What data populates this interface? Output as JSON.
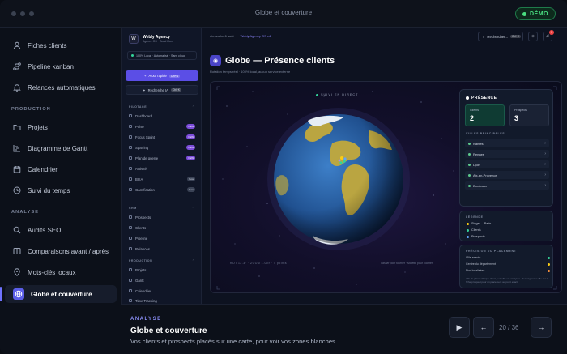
{
  "window": {
    "title": "Globe et couverture",
    "demo_badge": "DÉMO"
  },
  "left_nav": {
    "items_top": [
      "Fiches clients",
      "Pipeline kanban",
      "Relances automatiques"
    ],
    "section_production": "PRODUCTION",
    "items_production": [
      "Projets",
      "Diagramme de Gantt",
      "Calendrier",
      "Suivi du temps"
    ],
    "section_analyse": "ANALYSE",
    "items_analyse": [
      "Audits SEO",
      "Comparaisons avant / après",
      "Mots-clés locaux",
      "Globe et couverture"
    ],
    "active": "Globe et couverture"
  },
  "app": {
    "brand": {
      "name": "Webly Agency",
      "sub": "Agency OS · Good Run"
    },
    "local_status": "100% Local · Automatisé · Sans cloud",
    "quick_add": {
      "label": "Ajout rapide",
      "shortcut": "Ctrl+N"
    },
    "ai_search": {
      "label": "Recherche IA",
      "shortcut": "Ctrl+K"
    },
    "groups": {
      "pilotage": "PILOTAGE",
      "pilotage_items": [
        {
          "label": "Dashboard",
          "badge": ""
        },
        {
          "label": "Pulse",
          "badge": "NEW"
        },
        {
          "label": "Focus Sprint",
          "badge": "NEW"
        },
        {
          "label": "Sparring",
          "badge": "NEW"
        },
        {
          "label": "Plan de guerre",
          "badge": "NEW"
        },
        {
          "label": "Activité",
          "badge": ""
        },
        {
          "label": "BI IA",
          "badge": "Beta"
        },
        {
          "label": "Gamification",
          "badge": "Beta"
        }
      ],
      "crm": "CRM",
      "crm_items": [
        "Prospects",
        "Clients",
        "Pipeline",
        "Relances"
      ],
      "production": "PRODUCTION",
      "production_items": [
        "Projets",
        "Gantt",
        "Calendrier",
        "Time Tracking"
      ]
    },
    "breadcrumb": {
      "date": "dimanche 6 août",
      "context": "Webly Agency OS v4"
    },
    "search": {
      "label": "Rechercher...",
      "shortcut": "Ctrl+K"
    },
    "notifications": "1",
    "page_title": "Globe — Présence clients",
    "page_subtitle": "Rotation temps réel · 100% local, aucun service externe",
    "globe": {
      "live_label": "SUIVI EN DIRECT",
      "hud": "ROT 12.3°  ·  ZOOM 1.00×  ·  5 points",
      "hint": "Glisser pour tourner · Molette pour zoomer"
    },
    "presence": {
      "title": "PRÉSENCE",
      "clients_label": "Clients",
      "clients_value": "2",
      "prospects_label": "Prospects",
      "prospects_value": "3",
      "cities_title": "VILLES PRINCIPALES",
      "cities": [
        "Nantes",
        "Rennes",
        "Lyon",
        "Aix-en-Provence",
        "Bordeaux"
      ]
    },
    "legend": {
      "title": "LÉGENDE",
      "items": [
        {
          "label": "Siège — Paris",
          "color": "#facc15"
        },
        {
          "label": "Clients",
          "color": "#34d399"
        },
        {
          "label": "Prospects",
          "color": "#60a5fa"
        }
      ]
    },
    "precision": {
      "title": "PRÉCISION DU PLACEMENT",
      "rows": [
        {
          "label": "Ville exacte",
          "color": "#34d399"
        },
        {
          "label": "Centre du département",
          "color": "#facc15"
        },
        {
          "label": "Non localisées",
          "color": "#fb923c"
        }
      ],
      "note": "Afin de placer chaque client, leur ville est analysée. Renseignez la ville sur la fiche prospect pour un placement au point exact."
    }
  },
  "bottom": {
    "section": "ANALYSE",
    "title": "Globe et couverture",
    "description": "Vos clients et prospects placés sur une carte, pour voir vos zones blanches.",
    "counter": "20 / 36"
  }
}
